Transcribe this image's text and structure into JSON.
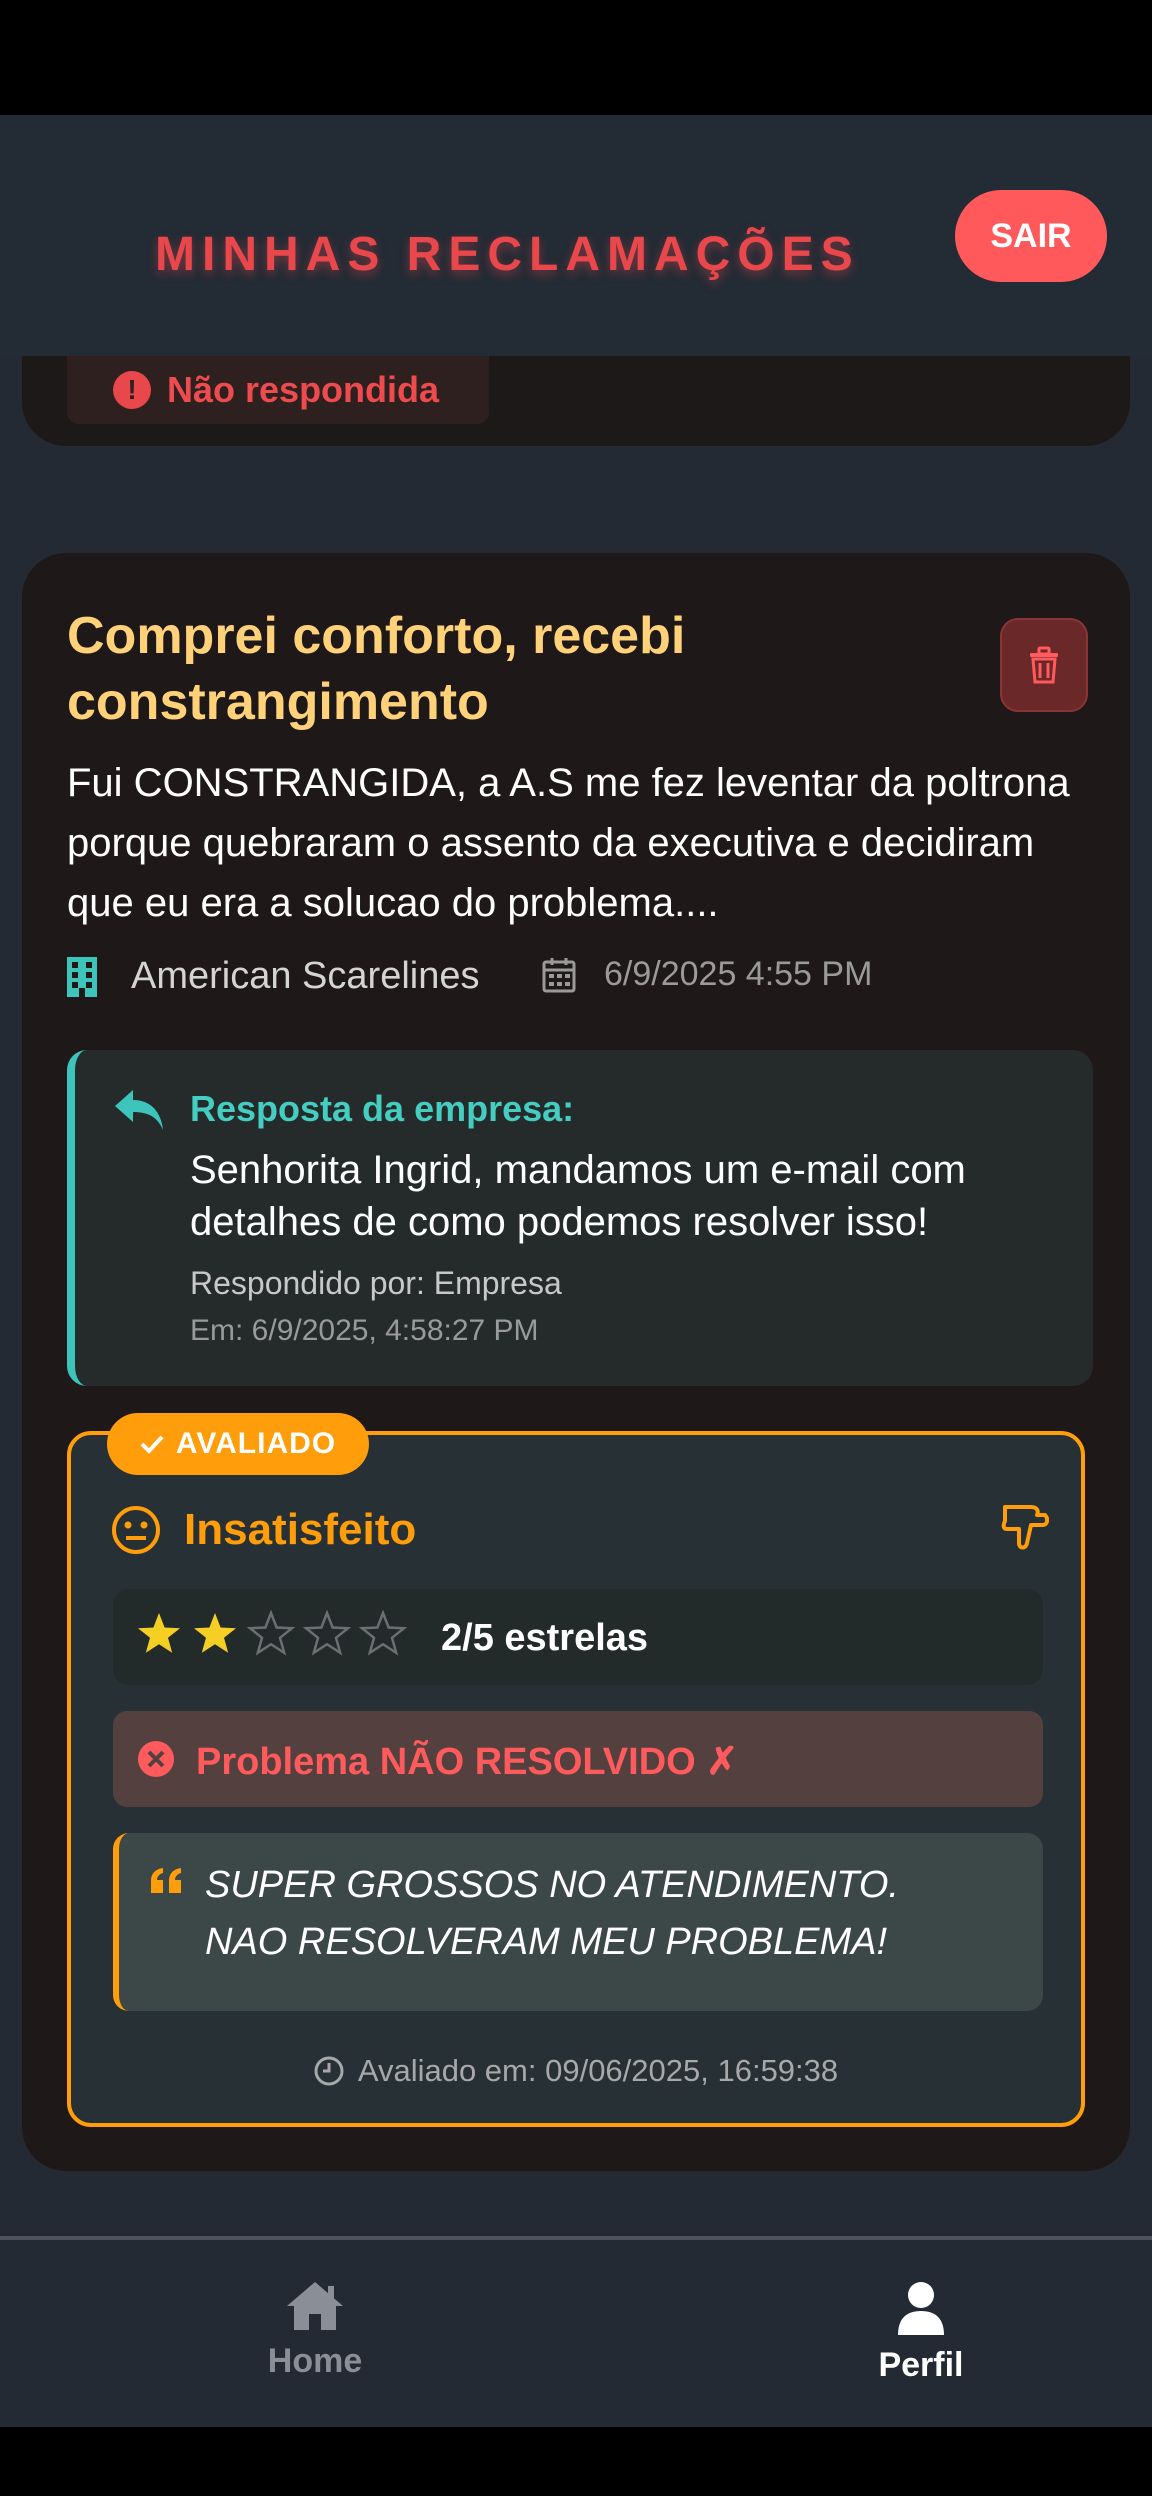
{
  "header": {
    "title": "MINHAS RECLAMAÇÕES",
    "logout_label": "SAIR"
  },
  "previous_card": {
    "status_label": "Não respondida"
  },
  "complaint": {
    "title": "Comprei conforto, recebi constrangimento",
    "description": "Fui CONSTRANGIDA, a A.S me fez leventar da poltrona porque quebraram o assento da executiva e decidiram que eu era a solucao do problema....",
    "company": "American Scarelines",
    "date": "6/9/2025 4:55 PM",
    "reply": {
      "label": "Resposta da empresa:",
      "text": "Senhorita Ingrid, mandamos um e-mail com detalhes de como podemos resolver isso!",
      "by": "Respondido por: Empresa",
      "at": "Em: 6/9/2025, 4:58:27 PM"
    },
    "evaluation": {
      "badge": "AVALIADO",
      "sentiment": "Insatisfeito",
      "rating": 2,
      "max_rating": 5,
      "rating_label": "2/5 estrelas",
      "resolution": "Problema NÃO RESOLVIDO ✗",
      "comment": "SUPER GROSSOS NO ATENDIMENTO. NAO RESOLVERAM MEU PROBLEMA!",
      "evaluated_at": "Avaliado em: 09/06/2025, 16:59:38"
    }
  },
  "tabs": [
    {
      "label": "Home",
      "icon": "home-icon",
      "active": false
    },
    {
      "label": "Perfil",
      "icon": "user-icon",
      "active": true
    }
  ],
  "colors": {
    "accent_red": "#e8474b",
    "title_yellow": "#ffd27a",
    "teal": "#3ec5bb",
    "orange": "#ff9d0a",
    "star_filled": "#f5cf23"
  }
}
